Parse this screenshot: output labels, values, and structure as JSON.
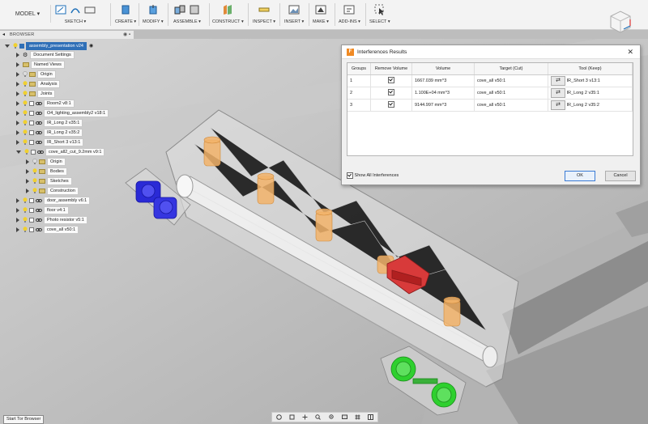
{
  "toolbar": {
    "mode": "MODEL",
    "groups": [
      "SKETCH",
      "CREATE",
      "MODIFY",
      "ASSEMBLE",
      "CONSTRUCT",
      "INSPECT",
      "INSERT",
      "MAKE",
      "ADD-INS",
      "SELECT"
    ]
  },
  "browser": {
    "title": "BROWSER",
    "items": [
      {
        "label": "assembly_presentation v24"
      },
      {
        "label": "Document Settings"
      },
      {
        "label": "Named Views"
      },
      {
        "label": "Origin"
      },
      {
        "label": "Analysis"
      },
      {
        "label": "Joints"
      },
      {
        "label": "Room2 v8:1"
      },
      {
        "label": "O4_lighting_assembly2 v18:1"
      },
      {
        "label": "IR_Long 2 v35:1"
      },
      {
        "label": "IR_Long 2 v35:2"
      },
      {
        "label": "IR_Short 3 v13:1"
      },
      {
        "label": "cove_all2_cut_9.2mm v9:1"
      },
      {
        "label": "Origin"
      },
      {
        "label": "Bodies"
      },
      {
        "label": "Sketches"
      },
      {
        "label": "Construction"
      },
      {
        "label": "door_assembly v6:1"
      },
      {
        "label": "floor v4:1"
      },
      {
        "label": "Photo resistor v5:1"
      },
      {
        "label": "cove_all v50:1"
      }
    ]
  },
  "dialog": {
    "title": "Interferences Results",
    "columns": [
      "Groups",
      "Remove Volume",
      "Volume",
      "Target (Cut)",
      "Tool (Keep)"
    ],
    "rows": [
      {
        "group": "1",
        "volume": "1667.039 mm^3",
        "target": "cove_all v50:1",
        "tool": "IR_Short 3 v13:1"
      },
      {
        "group": "2",
        "volume": "1.100E+04 mm^3",
        "target": "cove_all v50:1",
        "tool": "IR_Long 2 v35:1"
      },
      {
        "group": "3",
        "volume": "9144.997 mm^3",
        "target": "cove_all v50:1",
        "tool": "IR_Long 2 v35:2"
      }
    ],
    "show_all_label": "Show All Interferences",
    "ok_label": "OK",
    "cancel_label": "Cancel"
  },
  "taskbar_tip": "Start Tor Browser",
  "colors": {
    "accent": "#2f6fb7",
    "interference_blue": "#2a2ad6",
    "interference_red": "#d83a3a",
    "interference_green": "#2ed02e",
    "sensor_orange": "#f2b36a"
  }
}
